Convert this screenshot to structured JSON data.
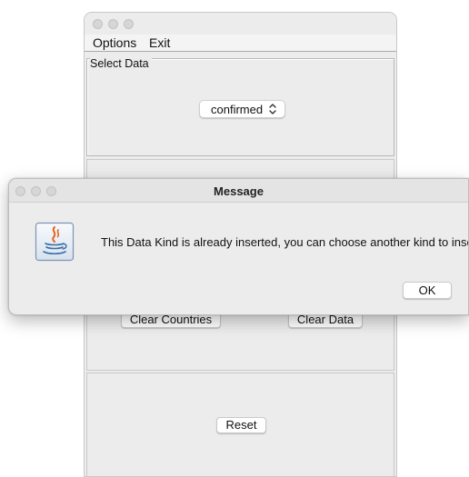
{
  "main_window": {
    "menu": {
      "options_label": "Options",
      "exit_label": "Exit"
    },
    "select_data_panel": {
      "legend": "Select Data",
      "selected_value": "confirmed"
    },
    "buttons": {
      "clear_countries": "Clear Countries",
      "clear_data": "Clear Data",
      "reset": "Reset"
    }
  },
  "dialog": {
    "title": "Message",
    "message": "This Data Kind is already inserted, you can choose another kind to insert",
    "ok_label": "OK",
    "icon": "java-icon"
  },
  "colors": {
    "window_bg": "#ececec",
    "button_bg": "#ffffff",
    "traffic_light_inactive": "#d6d6d6"
  }
}
